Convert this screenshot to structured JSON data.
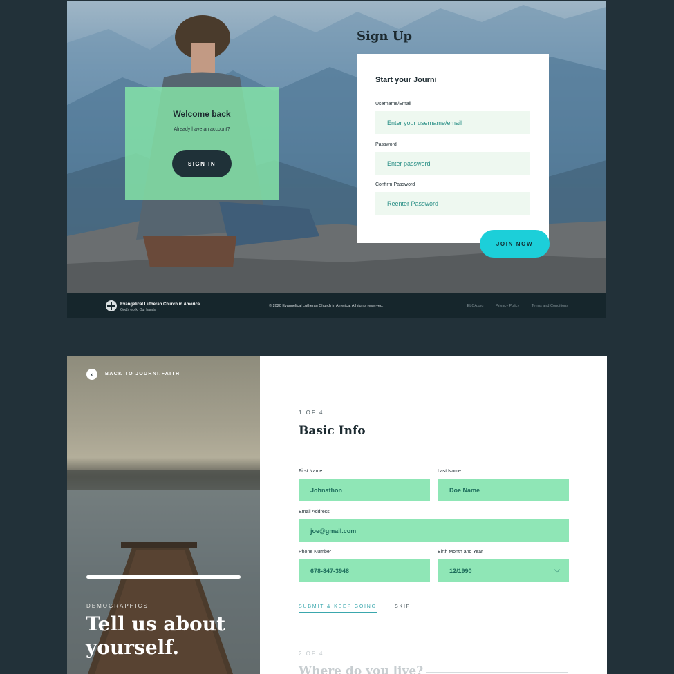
{
  "signin_panel": {
    "welcome_title": "Welcome back",
    "welcome_subtitle": "Already have an account?",
    "signin_button": "SIGN IN"
  },
  "signup": {
    "title": "Sign Up",
    "card_title": "Start your Journi",
    "fields": [
      {
        "label": "Username/Email",
        "placeholder": "Enter your username/email"
      },
      {
        "label": "Password",
        "placeholder": "Enter password"
      },
      {
        "label": "Confirm Password",
        "placeholder": "Reenter Password"
      }
    ],
    "join_button": "JOIN NOW",
    "accent_color": "#1ccfd9"
  },
  "footer": {
    "org_name": "Evangelical Lutheran Church in America",
    "tagline": "God's work. Our hands.",
    "copyright": "© 2020 Evangelical Lutheran Church in America. All rights reserved.",
    "links": [
      "ELCA.org",
      "Privacy Policy",
      "Terms and Conditions"
    ]
  },
  "onboarding": {
    "back_label": "BACK TO JOURNI.FAITH",
    "progress_fraction": 1.0,
    "kicker": "DEMOGRAPHICS",
    "heading": "Tell us about yourself.",
    "step_label": "1 OF 4",
    "section_title": "Basic Info",
    "fields": {
      "first_name": {
        "label": "First Name",
        "value": "Johnathon"
      },
      "last_name": {
        "label": "Last Name",
        "value": "Doe Name"
      },
      "email": {
        "label": "Email Address",
        "value": "joe@gmail.com"
      },
      "phone": {
        "label": "Phone Number",
        "value": "678-847-3948"
      },
      "birth": {
        "label": "Birth Month and Year",
        "value": "12/1990"
      }
    },
    "submit_label": "SUBMIT & KEEP GOING",
    "skip_label": "SKIP",
    "next_step_label": "2 OF 4",
    "next_section_title": "Where do you live?",
    "field_fill_color": "#8fe6b6"
  }
}
